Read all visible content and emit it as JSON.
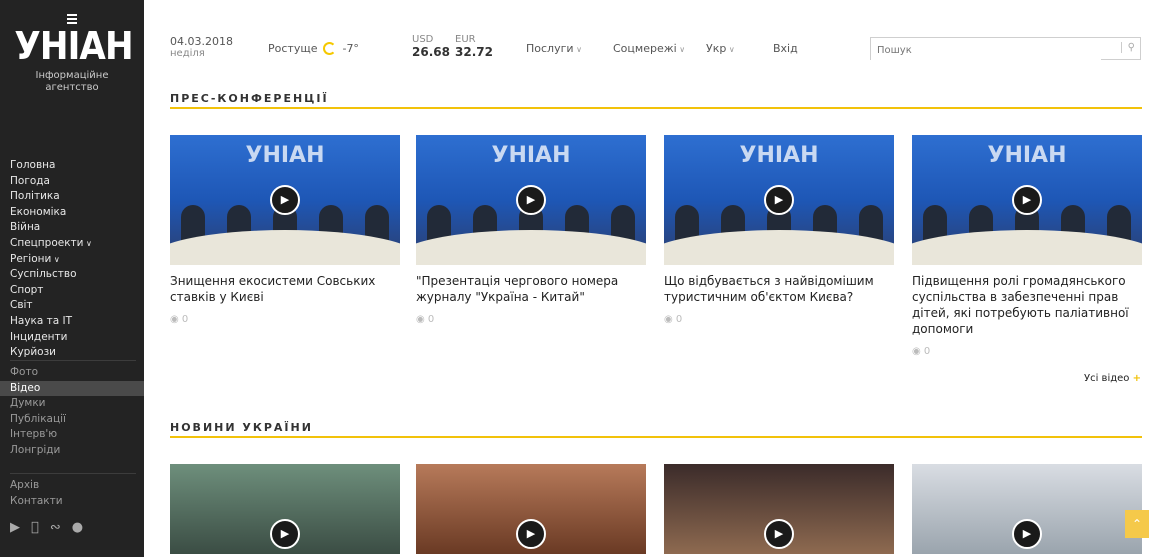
{
  "logo": {
    "word": "УНІАН",
    "subtitle": "Інформаційне агентство"
  },
  "sidebar": {
    "main": [
      "Головна",
      "Погода",
      "Політика",
      "Економіка",
      "Війна",
      "Спецпроекти",
      "Регіони",
      "Суспільство",
      "Спорт",
      "Світ",
      "Наука та IT",
      "Інциденти",
      "Курйози"
    ],
    "secondary": [
      "Фото",
      "Відео",
      "Думки",
      "Публікації",
      "Інтерв'ю",
      "Лонгріди"
    ],
    "secondary_active": "Відео",
    "tertiary": [
      "Архів",
      "Контакти"
    ],
    "social_icons": [
      "play-icon",
      "apple-icon",
      "rss-icon",
      "chat-icon"
    ]
  },
  "topbar": {
    "date": "04.03.2018",
    "day": "неділя",
    "city": "Ростуще",
    "temp": "-7°",
    "usd_label": "USD",
    "usd_value": "26.68",
    "eur_label": "EUR",
    "eur_value": "32.72",
    "services": "Послуги",
    "social": "Соцмережі",
    "lang": "Укр",
    "login": "Вхід",
    "search_placeholder": "Пошук"
  },
  "sections": {
    "press": {
      "title": "ПРЕС-КОНФЕРЕНЦІЇ",
      "cards": [
        {
          "title": "Знищення екосистеми Совських ставків у Києві",
          "views": "0",
          "brand": "УНІАН"
        },
        {
          "title": "\"Презентація чергового номера журналу \"Україна - Китай\"",
          "views": "0",
          "brand": "УНІАН"
        },
        {
          "title": "Що відбувається з найвідомішим туристичним об'єктом Києва?",
          "views": "0",
          "brand": "УНІАН"
        },
        {
          "title": "Підвищення ролі громадянського суспільства в забезпеченні прав дітей, які потребують паліативної допомоги",
          "views": "0",
          "brand": "УНІАН"
        }
      ],
      "all_label": "Усі відео"
    },
    "news": {
      "title": "НОВИНИ УКРАЇНИ"
    }
  },
  "colors": {
    "accent": "#f2c20a",
    "sidebar_bg": "#232323"
  }
}
